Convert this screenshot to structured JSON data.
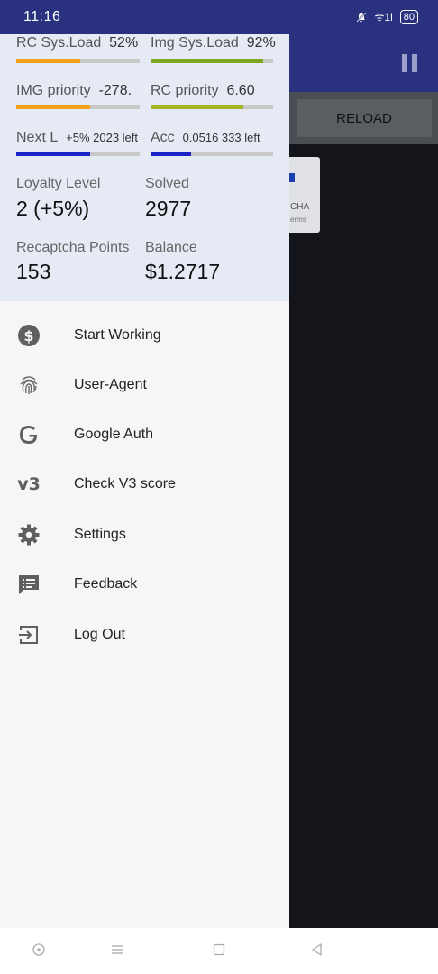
{
  "status_bar": {
    "time": "11:16",
    "signal": "ᯤ1l",
    "battery": "80"
  },
  "app": {
    "reload_label": "RELOAD",
    "captcha_text": "CHA",
    "captcha_terms": "erms"
  },
  "stats": {
    "rc_sys_load": {
      "label": "RC Sys.Load",
      "value": "52%",
      "fill": 0.52,
      "color": "#f2a31a"
    },
    "img_sys_load": {
      "label": "Img Sys.Load",
      "value": "92%",
      "fill": 0.92,
      "color": "#7fa621"
    },
    "img_priority": {
      "label": "IMG priority",
      "value": "-278.",
      "fill": 0.6,
      "color": "#f2a31a"
    },
    "rc_priority": {
      "label": "RC priority",
      "value": "6.60",
      "fill": 0.76,
      "color": "#a5b625"
    },
    "next_level": {
      "label": "Next L",
      "value": "+5% 2023 left",
      "fill": 0.6,
      "color": "#1b24c4"
    },
    "acc": {
      "label": "Acc",
      "value": "0.0516 333 left",
      "fill": 0.33,
      "color": "#1b24c4"
    }
  },
  "summary": {
    "loyalty_label": "Loyalty Level",
    "loyalty_value": "2 (+5%)",
    "solved_label": "Solved",
    "solved_value": "2977",
    "points_label": "Recaptcha Points",
    "points_value": "153",
    "balance_label": "Balance",
    "balance_value": "$1.2717"
  },
  "menu": [
    {
      "label": "Start Working",
      "icon": "dollar-icon"
    },
    {
      "label": "User-Agent",
      "icon": "fingerprint-icon"
    },
    {
      "label": "Google Auth",
      "icon": "google-icon"
    },
    {
      "label": "Check V3 score",
      "icon": "v3-icon"
    },
    {
      "label": "Settings",
      "icon": "gear-icon"
    },
    {
      "label": "Feedback",
      "icon": "feedback-icon"
    },
    {
      "label": "Log Out",
      "icon": "logout-icon"
    }
  ],
  "v3_icon_text": "v3"
}
